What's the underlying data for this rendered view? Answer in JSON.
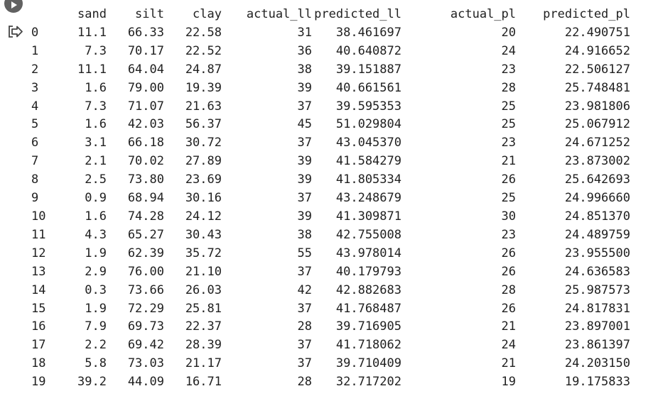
{
  "dataframe": {
    "columns": [
      "sand",
      "silt",
      "clay",
      "actual_ll",
      "predicted_ll",
      "actual_pl",
      "predicted_pl"
    ],
    "rows": [
      [
        "0",
        "11.1",
        "66.33",
        "22.58",
        "31",
        "38.461697",
        "20",
        "22.490751"
      ],
      [
        "1",
        "7.3",
        "70.17",
        "22.52",
        "36",
        "40.640872",
        "24",
        "24.916652"
      ],
      [
        "2",
        "11.1",
        "64.04",
        "24.87",
        "38",
        "39.151887",
        "23",
        "22.506127"
      ],
      [
        "3",
        "1.6",
        "79.00",
        "19.39",
        "39",
        "40.661561",
        "28",
        "25.748481"
      ],
      [
        "4",
        "7.3",
        "71.07",
        "21.63",
        "37",
        "39.595353",
        "25",
        "23.981806"
      ],
      [
        "5",
        "1.6",
        "42.03",
        "56.37",
        "45",
        "51.029804",
        "25",
        "25.067912"
      ],
      [
        "6",
        "3.1",
        "66.18",
        "30.72",
        "37",
        "43.045370",
        "23",
        "24.671252"
      ],
      [
        "7",
        "2.1",
        "70.02",
        "27.89",
        "39",
        "41.584279",
        "21",
        "23.873002"
      ],
      [
        "8",
        "2.5",
        "73.80",
        "23.69",
        "39",
        "41.805334",
        "26",
        "25.642693"
      ],
      [
        "9",
        "0.9",
        "68.94",
        "30.16",
        "37",
        "43.248679",
        "25",
        "24.996660"
      ],
      [
        "10",
        "1.6",
        "74.28",
        "24.12",
        "39",
        "41.309871",
        "30",
        "24.851370"
      ],
      [
        "11",
        "4.3",
        "65.27",
        "30.43",
        "38",
        "42.755008",
        "23",
        "24.489759"
      ],
      [
        "12",
        "1.9",
        "62.39",
        "35.72",
        "55",
        "43.978014",
        "26",
        "23.955500"
      ],
      [
        "13",
        "2.9",
        "76.00",
        "21.10",
        "37",
        "40.179793",
        "26",
        "24.636583"
      ],
      [
        "14",
        "0.3",
        "73.66",
        "26.03",
        "42",
        "42.882683",
        "28",
        "25.987573"
      ],
      [
        "15",
        "1.9",
        "72.29",
        "25.81",
        "37",
        "41.768487",
        "26",
        "24.817831"
      ],
      [
        "16",
        "7.9",
        "69.73",
        "22.37",
        "28",
        "39.716905",
        "21",
        "23.897001"
      ],
      [
        "17",
        "2.2",
        "69.42",
        "28.39",
        "37",
        "41.718062",
        "24",
        "23.861397"
      ],
      [
        "18",
        "5.8",
        "73.03",
        "21.17",
        "37",
        "39.710409",
        "21",
        "24.203150"
      ],
      [
        "19",
        "39.2",
        "44.09",
        "16.71",
        "28",
        "32.717202",
        "19",
        "19.175833"
      ]
    ]
  },
  "icons": {
    "run": "play-icon",
    "output": "output-redirect-icon"
  },
  "colors": {
    "text": "#212121",
    "run_button": "#616161",
    "icon": "#444444"
  }
}
